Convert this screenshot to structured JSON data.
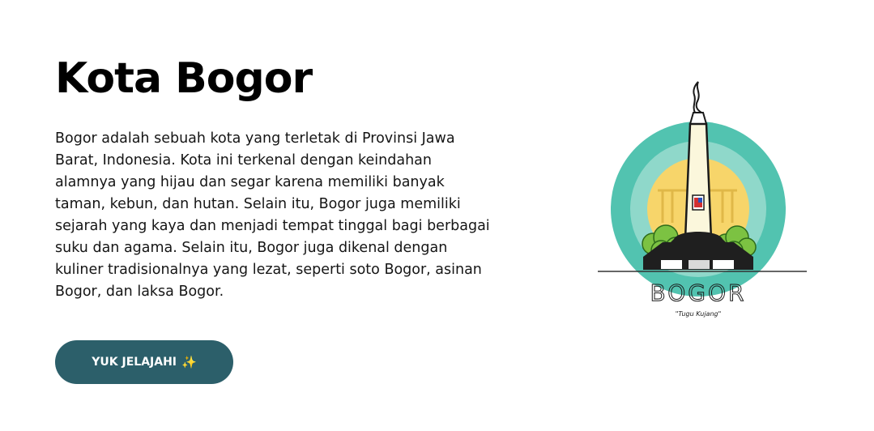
{
  "hero": {
    "title": "Kota Bogor",
    "description": "Bogor adalah sebuah kota yang terletak di Provinsi Jawa Barat, Indonesia. Kota ini terkenal dengan keindahan alamnya yang hijau dan segar karena memiliki banyak taman, kebun, dan hutan. Selain itu, Bogor juga memiliki sejarah yang kaya dan menjadi tempat tinggal bagi berbagai suku dan agama. Selain itu, Bogor juga dikenal dengan kuliner tradisionalnya yang lezat, seperti soto Bogor, asinan Bogor, dan laksa Bogor.",
    "cta_label": "YUK JELAJAHI",
    "cta_icon": "✨"
  },
  "illustration": {
    "wordmark": "BOGOR",
    "caption": "\"Tugu Kujang\""
  },
  "colors": {
    "button": "#2c5f6a",
    "teal_outer": "#52c3b0",
    "teal_inner": "#8fd8ca",
    "sun": "#f7d56a",
    "tree": "#7cc242"
  }
}
